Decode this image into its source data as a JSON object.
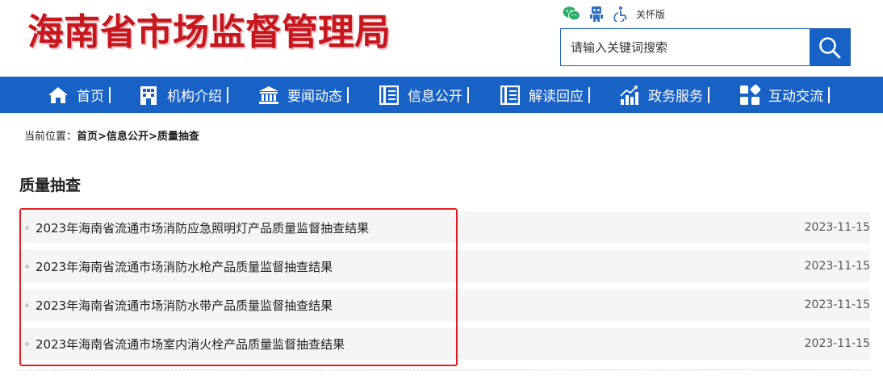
{
  "header": {
    "logo_text": "海南省市场监督管理局",
    "tools": {
      "elder_mode_label": "关怀版"
    },
    "search": {
      "placeholder": "请输入关键词搜索"
    }
  },
  "nav": {
    "items": [
      {
        "label": "首页",
        "icon": "home-icon"
      },
      {
        "label": "机构介绍",
        "icon": "building-icon"
      },
      {
        "label": "要闻动态",
        "icon": "bank-icon"
      },
      {
        "label": "信息公开",
        "icon": "list-book-icon"
      },
      {
        "label": "解读回应",
        "icon": "list-book-icon"
      },
      {
        "label": "政务服务",
        "icon": "bar-chart-icon"
      },
      {
        "label": "互动交流",
        "icon": "grid-icon"
      }
    ]
  },
  "breadcrumb": {
    "prefix": "当前位置：",
    "items": [
      "首页",
      "信息公开",
      "质量抽查"
    ],
    "separator": ">"
  },
  "section": {
    "title": "质量抽查"
  },
  "list": {
    "items": [
      {
        "title": "2023年海南省流通市场消防应急照明灯产品质量监督抽查结果",
        "date": "2023-11-15"
      },
      {
        "title": "2023年海南省流通市场消防水枪产品质量监督抽查结果",
        "date": "2023-11-15"
      },
      {
        "title": "2023年海南省流通市场消防水带产品质量监督抽查结果",
        "date": "2023-11-15"
      },
      {
        "title": "2023年海南省流通市场室内消火栓产品质量监督抽查结果",
        "date": "2023-11-15"
      }
    ]
  },
  "colors": {
    "brand_blue": "#1862c6",
    "logo_red": "#c8161d",
    "highlight_red": "#e02020",
    "wechat_green": "#2aae67"
  }
}
